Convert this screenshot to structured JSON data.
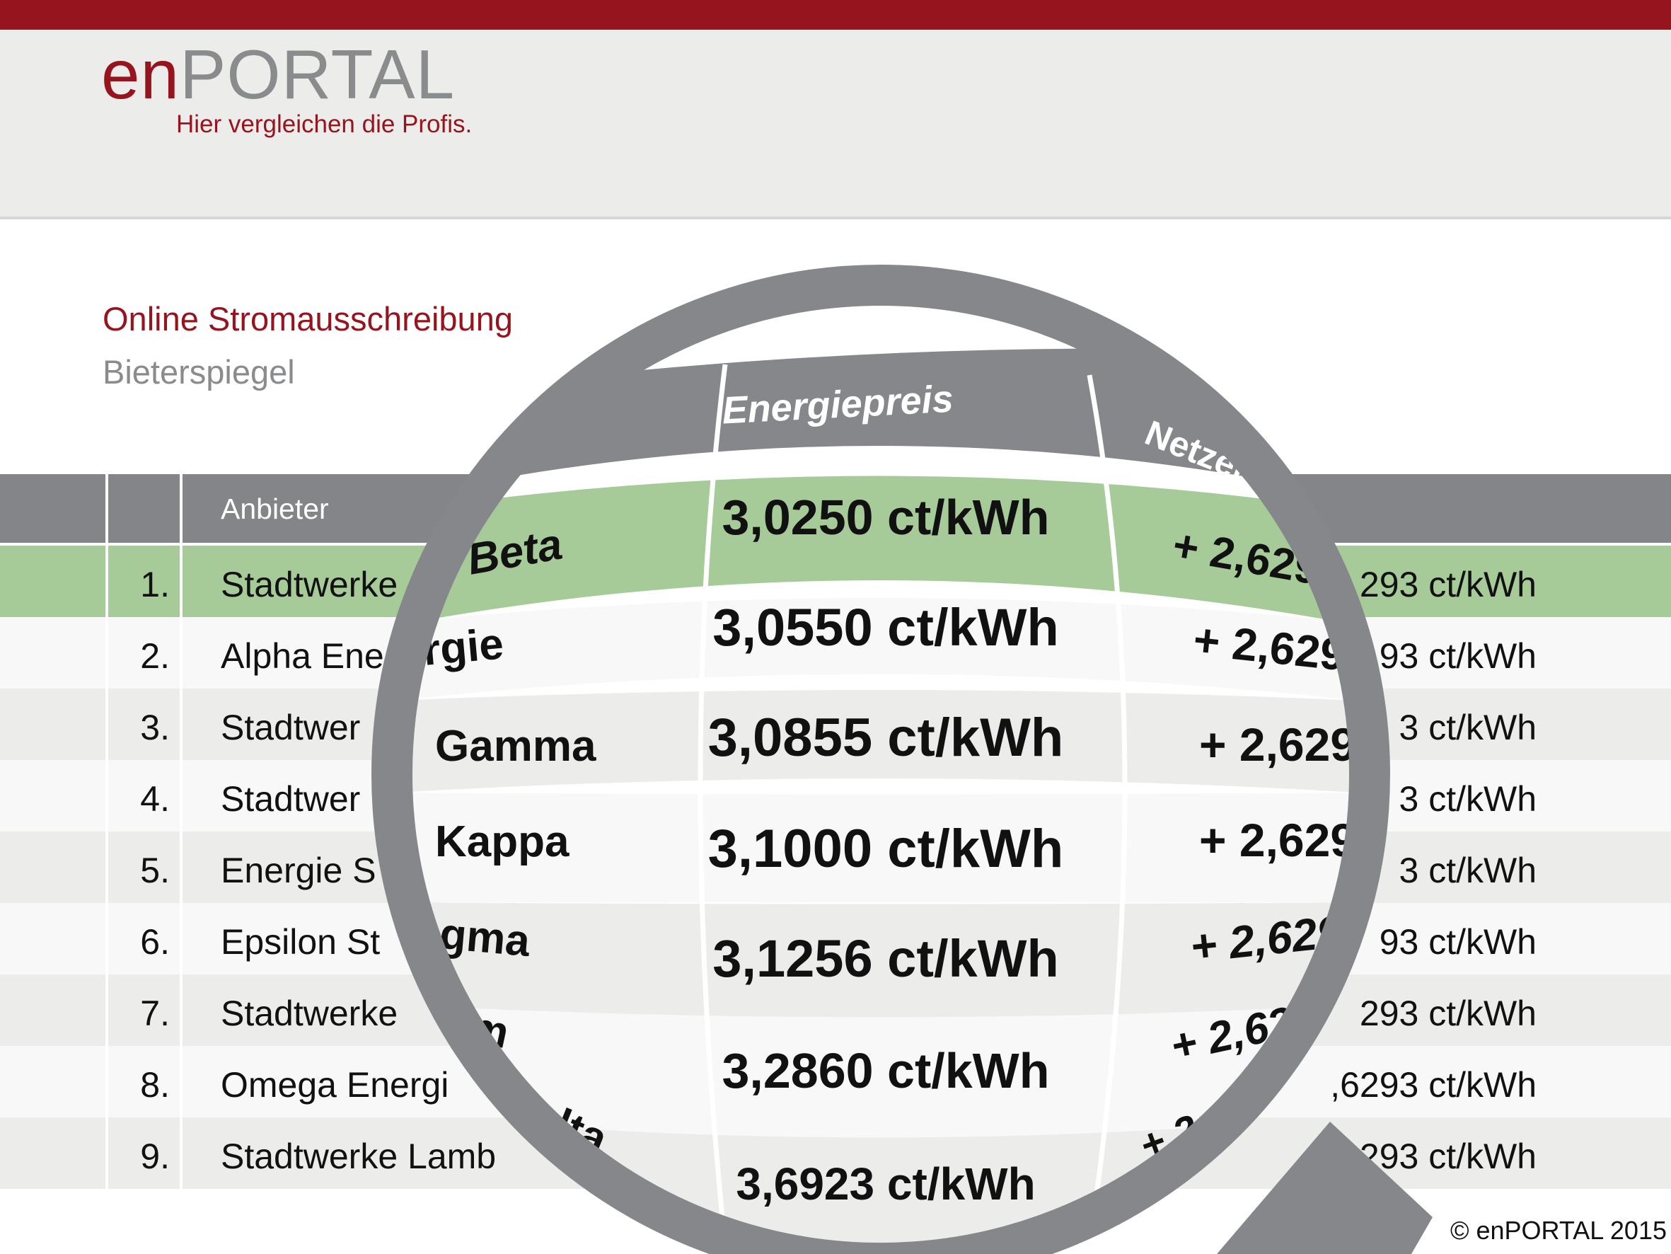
{
  "brand": {
    "logo_en": "en",
    "logo_portal": "PORTAL",
    "slogan": "Hier vergleichen die Profis."
  },
  "page": {
    "title": "Online Stromausschreibung",
    "subtitle": "Bieterspiegel"
  },
  "table": {
    "header_anbieter": "Anbieter",
    "rows": [
      {
        "rank": "1.",
        "name": "Stadtwerke",
        "netz": "293 ct/kWh"
      },
      {
        "rank": "2.",
        "name": "Alpha Ene",
        "netz": "93 ct/kWh"
      },
      {
        "rank": "3.",
        "name": "Stadtwer",
        "netz": "3 ct/kWh"
      },
      {
        "rank": "4.",
        "name": "Stadtwer",
        "netz": "3 ct/kWh"
      },
      {
        "rank": "5.",
        "name": "Energie S",
        "netz": "3 ct/kWh"
      },
      {
        "rank": "6.",
        "name": "Epsilon St",
        "netz": "93 ct/kWh"
      },
      {
        "rank": "7.",
        "name": "Stadtwerke",
        "netz": "293 ct/kWh"
      },
      {
        "rank": "8.",
        "name": "Omega Energi",
        "netz": ",6293 ct/kWh"
      },
      {
        "rank": "9.",
        "name": "Stadtwerke Lamb",
        "netz": "293 ct/kWh"
      }
    ]
  },
  "lens": {
    "header_energiepreis": "Energiepreis",
    "header_netz": "Netzen",
    "rows": [
      {
        "name": "Beta",
        "energiepreis": "3,0250 ct/kWh",
        "netz": "+ 2,629"
      },
      {
        "name": "rgie",
        "energiepreis": "3,0550 ct/kWh",
        "netz": "+ 2,629"
      },
      {
        "name": "Gamma",
        "energiepreis": "3,0855 ct/kWh",
        "netz": "+ 2,6293"
      },
      {
        "name": "Kappa",
        "energiepreis": "3,1000 ct/kWh",
        "netz": "+ 2,6293"
      },
      {
        "name": "gma",
        "energiepreis": "3,1256 ct/kWh",
        "netz": "+ 2,629"
      },
      {
        "name": "m",
        "energiepreis": "3,2860 ct/kWh",
        "netz": "+ 2,629"
      },
      {
        "name": "lta",
        "energiepreis": "3,6923 ct/kWh",
        "netz": "+ 2,6"
      }
    ]
  },
  "footer": {
    "copyright": "© enPORTAL 2015"
  },
  "colors": {
    "brand_red": "#96141e",
    "header_gray": "#848588",
    "highlight_green": "#a7cb98",
    "lens_frame": "#86878a"
  }
}
